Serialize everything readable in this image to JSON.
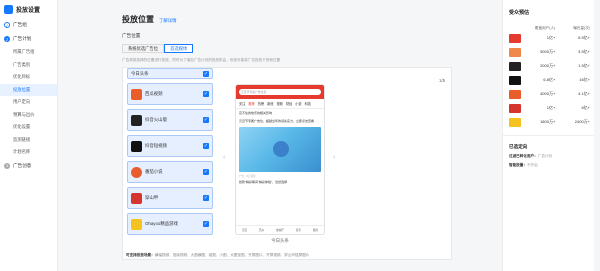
{
  "app": {
    "title": "投放设置"
  },
  "sidebar": {
    "items": [
      {
        "label": "广告组",
        "num": "✓"
      },
      {
        "label": "广告计划",
        "num": "2"
      }
    ],
    "subitems": [
      "所属广告组",
      "广告类别",
      "优化目标",
      "投放位置",
      "用户定向",
      "预算与出价",
      "优化设置",
      "监测链接",
      "计划名称"
    ],
    "last": {
      "label": "广告创意",
      "num": "3"
    }
  },
  "main": {
    "title": "投放位置",
    "link": "了解详情",
    "label": "广告位置",
    "buttons": [
      "系统优选广告位",
      "首选媒体"
    ],
    "tip": "广告将按选择的位置进行投放，同时为了增加广告计划的投放机会，系统可能将广告投放于其他位置"
  },
  "placements": [
    "今日头条",
    "西瓜视频",
    "抖音火山版",
    "抖音短视频",
    "番茄小说",
    "穿山甲",
    "Ohayoo精品游戏"
  ],
  "preview": {
    "page": "1/5",
    "search": "元旦节专属广告位置",
    "tabs": [
      "关注",
      "推荐",
      "热榜",
      "新冠",
      "视频",
      "财经",
      "小说",
      "科技"
    ],
    "headline1": "忍不住的快乐的相关影响",
    "headline2": "元旦节专属广告位，超越全年的领先实力，立即点击查看",
    "meta": "广告 · 5万评论",
    "headline3": "抢锋“精彩瞬间“精彩体验”，当然选择",
    "bottom": [
      "首页",
      "西瓜",
      "放映厅",
      "任务",
      "我的"
    ],
    "caption": "今日头条"
  },
  "note": {
    "label": "可支持投放场景：",
    "text": "横幅视频、竖版视频、大图横图、组图、小图、大图竖图、开屏图片、开屏视频、穿山甲插屏图片"
  },
  "estimate": {
    "title": "受众预估",
    "headers": [
      "覆盖用户(人)",
      "曝光量(次)"
    ],
    "rows": [
      {
        "c1": "1亿+",
        "c2": "6.5亿+",
        "color": "#e63a2e"
      },
      {
        "c1": "9000万+",
        "c2": "3.5亿+",
        "color": "#f0884a"
      },
      {
        "c1": "2000万+",
        "c2": "1.5亿+",
        "color": "#222"
      },
      {
        "c1": "6.8亿+",
        "c2": "16亿+",
        "color": "#111"
      },
      {
        "c1": "4000万+",
        "c2": "4.1亿+",
        "color": "#e85d2a"
      },
      {
        "c1": "1亿+",
        "c2": "6亿+",
        "color": "#d6352d"
      },
      {
        "c1": "1800万+",
        "c2": "2400万+",
        "color": "#f5c320"
      }
    ],
    "selected_title": "已选定向",
    "kv": [
      {
        "k": "过滤已转化用户：",
        "v": "广告计划"
      },
      {
        "k": "智能放量：",
        "v": "不开启"
      }
    ]
  }
}
